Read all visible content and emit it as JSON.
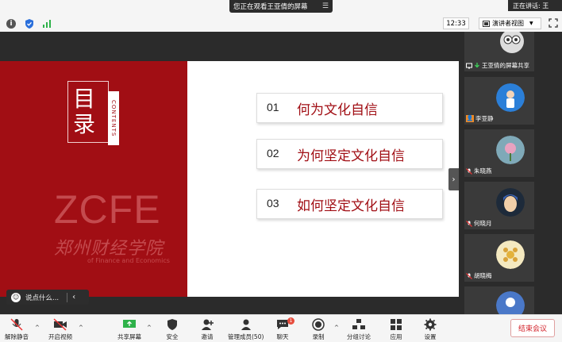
{
  "top": {
    "share_banner": "您正在观看王亚倩的屏幕",
    "speaking": "正在讲话: 王",
    "time": "12:33",
    "view_button": "演讲者视图"
  },
  "slide": {
    "title_chars": [
      "目",
      "录"
    ],
    "contents_label": "CONTENTS",
    "logo_text": "ZCFE",
    "school_cn": "郑州财经学院",
    "school_en": "of Finance and Economics",
    "items": [
      {
        "num": "01",
        "text": "何为文化自信"
      },
      {
        "num": "02",
        "text": "为何坚定文化自信"
      },
      {
        "num": "03",
        "text": "如何坚定文化自信"
      }
    ]
  },
  "chat": {
    "placeholder": "说点什么..."
  },
  "participants": [
    {
      "name": "王亚倩的屏幕共享",
      "icon": "screen-share-icon"
    },
    {
      "name": "李亚静",
      "icon": "person-icon"
    },
    {
      "name": "朱晓燕",
      "icon": "mic-off-icon"
    },
    {
      "name": "何晓月",
      "icon": "mic-off-icon"
    },
    {
      "name": "胡晓梅",
      "icon": "mic-off-icon"
    }
  ],
  "toolbar": {
    "unmute": "解除静音",
    "video": "开启视频",
    "share": "共享屏幕",
    "security": "安全",
    "invite": "邀请",
    "manage": "管理成员(50)",
    "chat": "聊天",
    "chat_badge": "1",
    "record": "录制",
    "breakout": "分组讨论",
    "apps": "应用",
    "settings": "设置",
    "end": "结束会议"
  },
  "colors": {
    "brand_red": "#a10e14",
    "end_red": "#d3232b"
  }
}
